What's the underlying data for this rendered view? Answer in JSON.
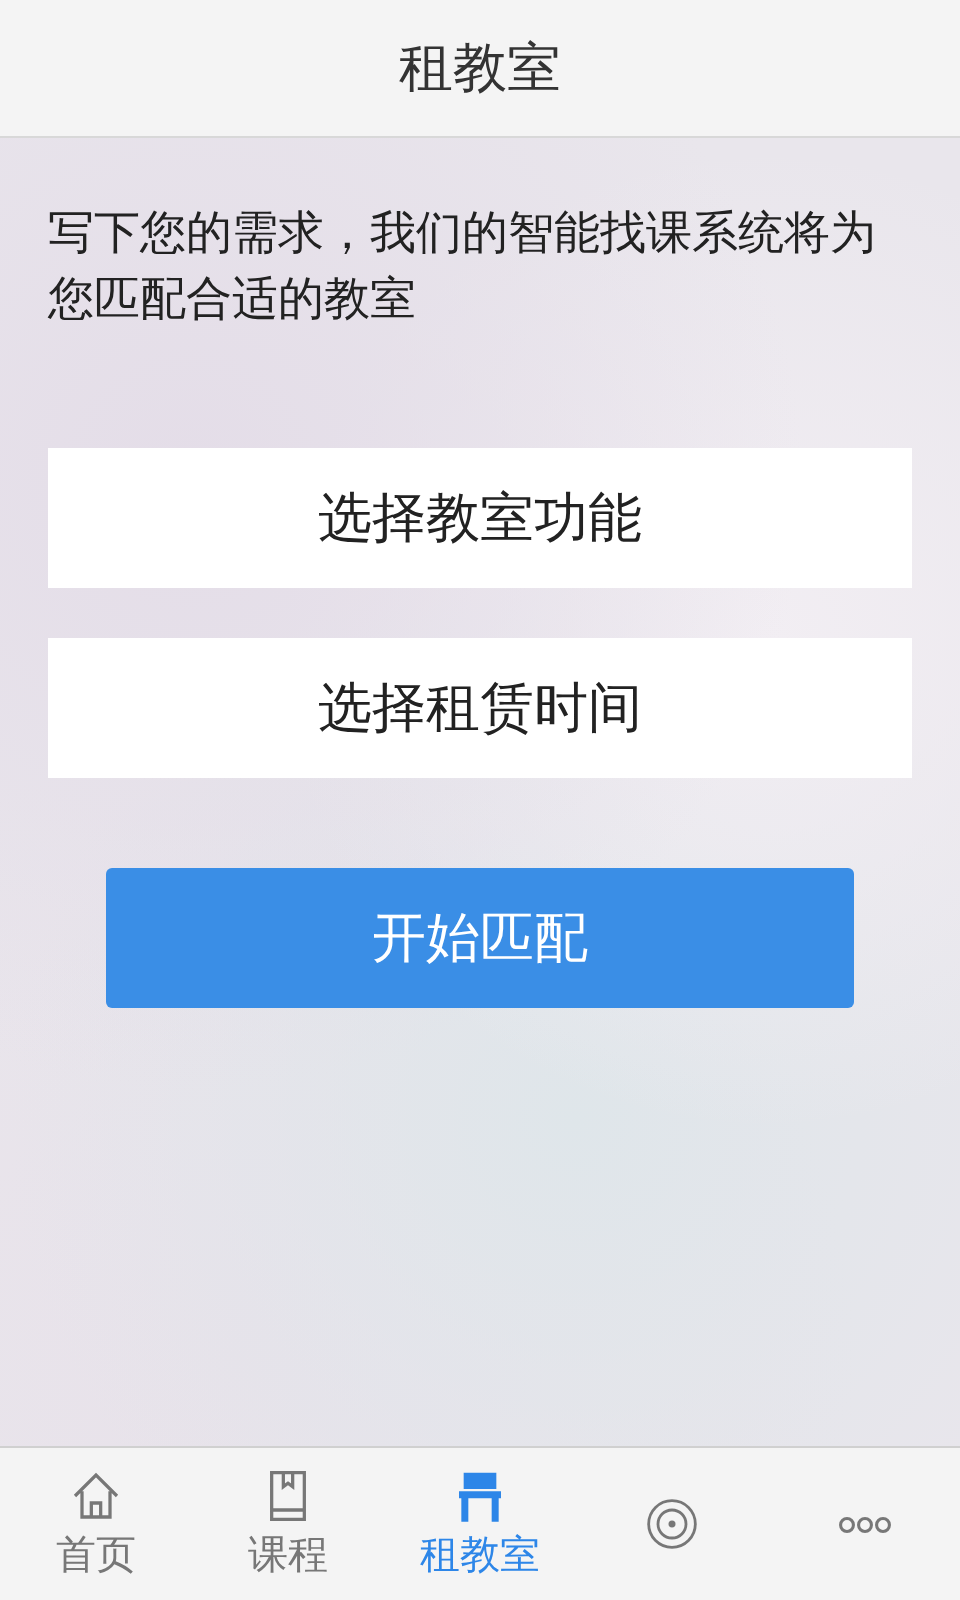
{
  "header": {
    "title": "租教室"
  },
  "intro": "写下您的需求，我们的智能找课系统将为您匹配合适的教室",
  "options": [
    {
      "label": "选择教室功能"
    },
    {
      "label": "选择租赁时间"
    }
  ],
  "primary_button": "开始匹配",
  "tab_bar": [
    {
      "kind": "home",
      "label": "首页",
      "selected": false
    },
    {
      "kind": "book",
      "label": "课程",
      "selected": false
    },
    {
      "kind": "classroom",
      "label": "租教室",
      "selected": true
    },
    {
      "kind": "target",
      "selected": false
    },
    {
      "kind": "more",
      "selected": false
    }
  ]
}
